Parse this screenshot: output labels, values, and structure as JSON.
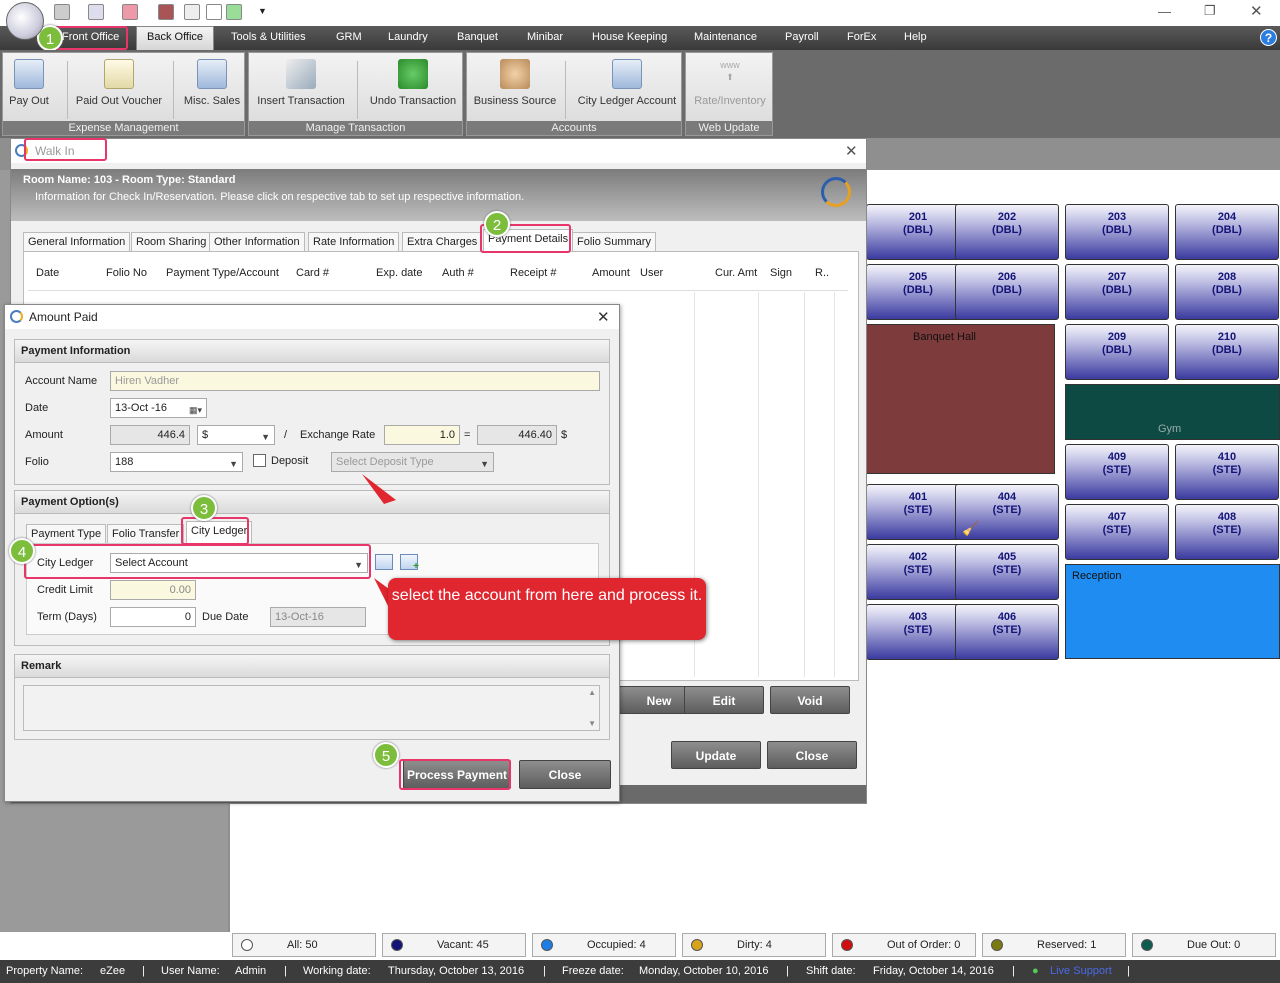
{
  "menu": {
    "items": [
      "Front Office",
      "Back Office",
      "Tools & Utilities",
      "GRM",
      "Laundry",
      "Banquet",
      "Minibar",
      "House Keeping",
      "Maintenance",
      "Payroll",
      "ForEx",
      "Help"
    ]
  },
  "ribbon": {
    "buttons": [
      "Pay Out",
      "Paid Out Voucher",
      "Misc. Sales",
      "Insert Transaction",
      "Undo Transaction",
      "Business Source",
      "City Ledger Account",
      "Rate/Inventory"
    ],
    "groups": [
      "Expense Management",
      "Manage Transaction",
      "Accounts",
      "Web Update"
    ],
    "www": "www"
  },
  "walkin": {
    "title": "Walk In",
    "header": "Room Name: 103 - Room Type: Standard",
    "subheader": "Information for Check In/Reservation. Please click on respective tab to set up respective information.",
    "tabs": [
      "General Information",
      "Room Sharing",
      "Other Information",
      "Rate Information",
      "Extra Charges",
      "Payment Details",
      "Folio Summary"
    ],
    "columns": [
      "Date",
      "Folio No",
      "Payment Type/Account",
      "Card #",
      "Exp. date",
      "Auth #",
      "Receipt #",
      "Amount",
      "User",
      "Cur. Amt",
      "Sign",
      "R.."
    ],
    "buttons": {
      "new": "New",
      "edit": "Edit",
      "void": "Void",
      "update": "Update",
      "close": "Close"
    }
  },
  "amount_paid": {
    "title": "Amount Paid",
    "payment_info": "Payment Information",
    "account_name_label": "Account Name",
    "account_name": "Hiren Vadher",
    "date_label": "Date",
    "date": "13-Oct -16",
    "amount_label": "Amount",
    "amount": "446.4",
    "currency": "$",
    "slash": "/",
    "exchange_label": "Exchange Rate",
    "exchange": "1.0",
    "equals": "=",
    "converted": "446.40",
    "converted_currency": "$",
    "folio_label": "Folio",
    "folio": "188",
    "deposit_label": "Deposit",
    "deposit_type_placeholder": "Select Deposit Type",
    "payment_options": "Payment Option(s)",
    "option_tabs": [
      "Payment Type",
      "Folio Transfer",
      "City Ledger"
    ],
    "city_ledger_label": "City Ledger",
    "city_ledger": "Select Account",
    "credit_limit_label": "Credit Limit",
    "credit_limit": "0.00",
    "term_label": "Term (Days)",
    "term": "0",
    "due_date_label": "Due Date",
    "due_date": "13-Oct-16",
    "remark": "Remark",
    "process_button": "Process Payment",
    "close_button": "Close"
  },
  "callout": "select the account from here and process it.",
  "badges": [
    "1",
    "2",
    "3",
    "4",
    "5"
  ],
  "rooms": [
    {
      "num": "201",
      "type": "(DBL)"
    },
    {
      "num": "202",
      "type": "(DBL)"
    },
    {
      "num": "203",
      "type": "(DBL)"
    },
    {
      "num": "204",
      "type": "(DBL)"
    },
    {
      "num": "205",
      "type": "(DBL)"
    },
    {
      "num": "206",
      "type": "(DBL)"
    },
    {
      "num": "207",
      "type": "(DBL)"
    },
    {
      "num": "208",
      "type": "(DBL)"
    },
    {
      "num": "209",
      "type": "(DBL)"
    },
    {
      "num": "210",
      "type": "(DBL)"
    },
    {
      "num": "409",
      "type": "(STE)"
    },
    {
      "num": "410",
      "type": "(STE)"
    },
    {
      "num": "401",
      "type": "(STE)"
    },
    {
      "num": "404",
      "type": "(STE)"
    },
    {
      "num": "407",
      "type": "(STE)"
    },
    {
      "num": "408",
      "type": "(STE)"
    },
    {
      "num": "402",
      "type": "(STE)"
    },
    {
      "num": "405",
      "type": "(STE)"
    },
    {
      "num": "403",
      "type": "(STE)"
    },
    {
      "num": "406",
      "type": "(STE)"
    }
  ],
  "areas": {
    "banquet": "Banquet Hall",
    "gym": "Gym",
    "reception": "Reception"
  },
  "status": [
    {
      "label": "All: 50",
      "color": "#ffffff"
    },
    {
      "label": "Vacant: 45",
      "color": "#141478"
    },
    {
      "label": "Occupied: 4",
      "color": "#1e7ee8"
    },
    {
      "label": "Dirty: 4",
      "color": "#d9a21b"
    },
    {
      "label": "Out of Order: 0",
      "color": "#d01010"
    },
    {
      "label": "Reserved: 1",
      "color": "#7a7a10"
    },
    {
      "label": "Due Out: 0",
      "color": "#0f5a50"
    }
  ],
  "footer": {
    "property_label": "Property Name:",
    "property": "eZee",
    "user_label": "User Name:",
    "user": "Admin",
    "working_label": "Working date:",
    "working": "Thursday, October 13, 2016",
    "freeze_label": "Freeze date:",
    "freeze": "Monday, October 10, 2016",
    "shift_label": "Shift date:",
    "shift": "Friday, October 14, 2016",
    "support": "Live Support",
    "sep": "|"
  },
  "colors": {
    "highlight": "#e8356a",
    "badge": "#7cbe3c",
    "callout": "#e0262e",
    "banquet": "#7e3b3b",
    "gym": "#0e4a44",
    "reception": "#1e8cf0"
  }
}
